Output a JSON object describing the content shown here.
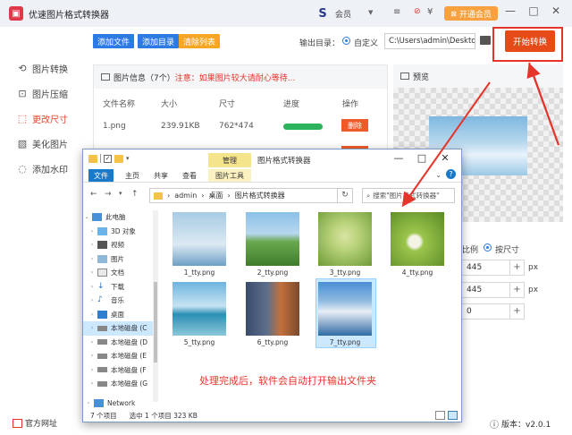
{
  "app": {
    "title": "优速图片格式转换器",
    "user_name": "会员",
    "vip_label": "开通会员",
    "win_controls": [
      "—",
      "□",
      "✕"
    ]
  },
  "nav": [
    {
      "label": "图片转换",
      "icon": "refresh-icon",
      "active": false
    },
    {
      "label": "图片压缩",
      "icon": "compress-icon",
      "active": false
    },
    {
      "label": "更改尺寸",
      "icon": "resize-icon",
      "active": true
    },
    {
      "label": "美化图片",
      "icon": "beautify-icon",
      "active": false
    },
    {
      "label": "添加水印",
      "icon": "watermark-icon",
      "active": false
    }
  ],
  "toolbar": {
    "add_file": "添加文件",
    "add_dir": "添加目录",
    "clear_list": "清除列表",
    "output_label": "输出目录：",
    "radio_custom": "自定义",
    "output_path": "C:\\Users\\admin\\Deskto",
    "start": "开始转换"
  },
  "info": {
    "title": "图片信息（7个）",
    "warning": "注意：如果图片较大请耐心等待...",
    "columns": [
      "文件名称",
      "大小",
      "尺寸",
      "进度",
      "操作"
    ],
    "rows": [
      {
        "name": "1.png",
        "size": "239.91KB",
        "dims": "762*474",
        "action": "删除"
      }
    ],
    "delete_label": "删除"
  },
  "preview": {
    "title": "预览",
    "ratio_label": "比例",
    "by_size_label": "按尺寸",
    "width": "445",
    "height": "445",
    "third": "0",
    "unit": "px"
  },
  "bottom": {
    "website": "官方网址",
    "version": "版本：v2.0.1"
  },
  "explorer": {
    "tool_tab": "管理",
    "title": "图片格式转换器",
    "ribbon": [
      "文件",
      "主页",
      "共享",
      "查看",
      "图片工具"
    ],
    "breadcrumb": [
      "admin",
      "桌面",
      "图片格式转换器"
    ],
    "search_placeholder": "搜索\"图片格式转换器\"",
    "tree": [
      {
        "label": "此电脑",
        "icon": "pc-icon",
        "expanded": true
      },
      {
        "label": "3D 对象",
        "icon": "3d-objects-icon"
      },
      {
        "label": "视频",
        "icon": "video-icon"
      },
      {
        "label": "图片",
        "icon": "pictures-icon"
      },
      {
        "label": "文档",
        "icon": "documents-icon"
      },
      {
        "label": "下载",
        "icon": "downloads-icon"
      },
      {
        "label": "音乐",
        "icon": "music-icon"
      },
      {
        "label": "桌面",
        "icon": "desktop-icon"
      },
      {
        "label": "本地磁盘 (C",
        "icon": "drive-icon",
        "selected": true
      },
      {
        "label": "本地磁盘 (D",
        "icon": "drive-icon"
      },
      {
        "label": "本地磁盘 (E",
        "icon": "drive-icon"
      },
      {
        "label": "本地磁盘 (F",
        "icon": "drive-icon"
      },
      {
        "label": "本地磁盘 (G",
        "icon": "drive-icon"
      },
      {
        "label": "Network",
        "icon": "network-icon"
      }
    ],
    "files": [
      {
        "name": "1_tty.png",
        "colors": [
          "#a8cbe4",
          "#dbe9f2",
          "#6e9fc6"
        ]
      },
      {
        "name": "2_tty.png",
        "colors": [
          "#8cc0e8",
          "#6aa84f",
          "#3f7d2a"
        ]
      },
      {
        "name": "3_tty.png",
        "colors": [
          "#b8d27a",
          "#6d9b37",
          "#d9e4a3"
        ]
      },
      {
        "name": "4_tty.png",
        "colors": [
          "#9bc54b",
          "#f3f3e6",
          "#5a8a26"
        ]
      },
      {
        "name": "5_tty.png",
        "colors": [
          "#6fb3e0",
          "#2b8fb5",
          "#8cc7d9"
        ]
      },
      {
        "name": "6_tty.png",
        "colors": [
          "#3a4c6b",
          "#c2703c",
          "#7a4a2e"
        ]
      },
      {
        "name": "7_tty.png",
        "colors": [
          "#4a8fd6",
          "#e8eef4",
          "#2f6aa6"
        ],
        "selected": true
      }
    ],
    "caption": "处理完成后，软件会自动打开输出文件夹",
    "status_count": "7 个项目",
    "status_selected": "选中 1 个项目  323 KB"
  }
}
